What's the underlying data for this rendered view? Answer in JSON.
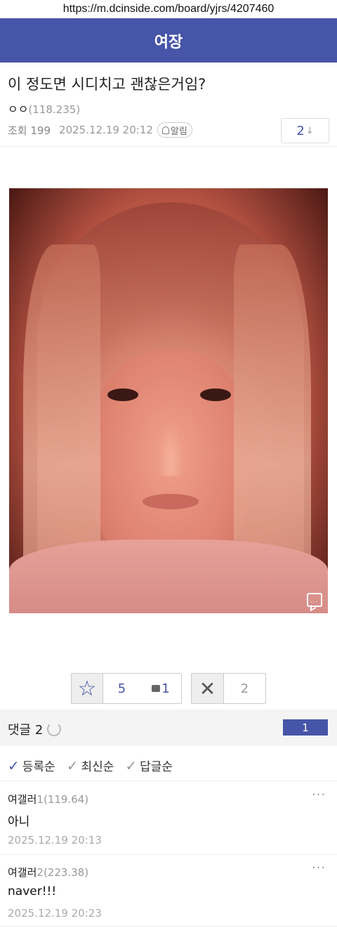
{
  "browser": {
    "url": "https://m.dcinside.com/board/yjrs/4207460"
  },
  "header": {
    "title": "여장"
  },
  "post": {
    "title": "이 정도면 시디치고 괜찮은거임?",
    "author": "ㅇㅇ",
    "author_ip": "(118.235)",
    "views_label": "조회",
    "views": "199",
    "date": "2025.12.19 20:12",
    "alarm_label": "알림",
    "comment_jump_count": "2",
    "comment_jump_arrow": "↓"
  },
  "votes": {
    "up_count": "5",
    "fix_count": "1",
    "down_count": "2"
  },
  "comments_section": {
    "title": "댓글 2",
    "page": "1",
    "sort_options": [
      {
        "label": "등록순",
        "active": true
      },
      {
        "label": "최신순",
        "active": false
      },
      {
        "label": "답글순",
        "active": false
      }
    ]
  },
  "comments": [
    {
      "author": "여갤러",
      "number": "1",
      "ip": "(119.64)",
      "body": "아니",
      "date": "2025.12.19 20:13",
      "more": "···"
    },
    {
      "author": "여갤러",
      "number": "2",
      "ip": "(223.38)",
      "body": "naver!!!",
      "date": "2025.12.19 20:23",
      "more": "···"
    }
  ]
}
